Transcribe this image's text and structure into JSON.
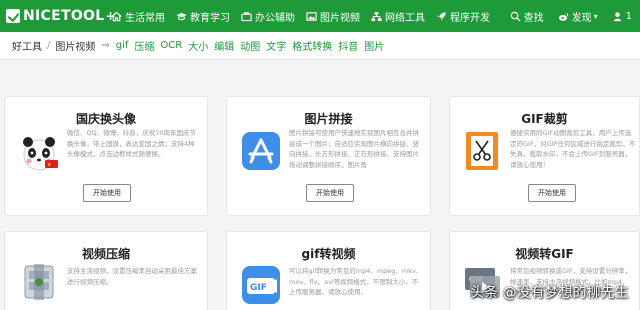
{
  "nav": {
    "logo": "NICETOOL",
    "logo_plus": "+",
    "items": [
      {
        "label": "生活常用",
        "icon": "home-icon"
      },
      {
        "label": "教育学习",
        "icon": "graduation-cap-icon"
      },
      {
        "label": "办公辅助",
        "icon": "briefcase-icon"
      },
      {
        "label": "图片视频",
        "icon": "image-icon"
      },
      {
        "label": "网络工具",
        "icon": "network-icon"
      },
      {
        "label": "程序开发",
        "icon": "rocket-icon"
      }
    ],
    "search": "查找",
    "share": "发现",
    "share_caret": "▾",
    "user": "1"
  },
  "breadcrumb": {
    "home": "好工具",
    "sep": "/",
    "current": "图片视频",
    "arrow": "⇒",
    "tags": [
      "gif",
      "压缩",
      "OCR",
      "大小",
      "编辑",
      "动图",
      "文字",
      "格式转换",
      "抖音",
      "图片"
    ]
  },
  "cards": [
    {
      "title": "国庆换头像",
      "desc": "微信、QQ、微博、抖音，庆祝70周年国庆节换头像，带上国旗，表达爱国之情；支持4种头像模式，点击边框样式随便换。",
      "button": "开始使用",
      "icon": "panda-icon"
    },
    {
      "title": "图片拼接",
      "desc": "图片拼接可使用户快速地实现图片相互合并拼接成一个图片；自适应实现图片横向拼接、竖向拼接、长方形拼接、正方形拼接，支持图片拖动调整拼接顺序，图片角",
      "button": "开始使用",
      "icon": "app-store-icon"
    },
    {
      "title": "GIF裁剪",
      "desc": "便捷实用的GIF动图裁剪工具，用户上传选定的GIF，对GIF任何区域进行指定裁剪，不失真，裁取水印，不会上传GIF到服务器，请放心使用！",
      "button": "开始使用",
      "icon": "film-scissors-icon"
    },
    {
      "title": "视频压缩",
      "desc": "支持主流视频，设置压缩率自动采用最佳方案进行视频压缩。",
      "button": "",
      "icon": "compress-icon"
    },
    {
      "title": "gif转视频",
      "desc": "可以将gif转换为常见的mp4、mpeg、mkv、mov、flv、avi等视频格式，不限制大小，不上传服务器，请放心使用。",
      "button": "",
      "icon": "gif-icon"
    },
    {
      "title": "视频转GIF",
      "desc": "将常见视频转换成GIF，支持设置分辨率，帧速率，支持主流视频格式，比如mp4、mkv、mov、flv、avi等，只需",
      "button": "",
      "icon": "video-gif-icon"
    }
  ],
  "watermark": "头条 @没有梦想的柳先生",
  "colors": {
    "brand": "#1e9a39"
  }
}
